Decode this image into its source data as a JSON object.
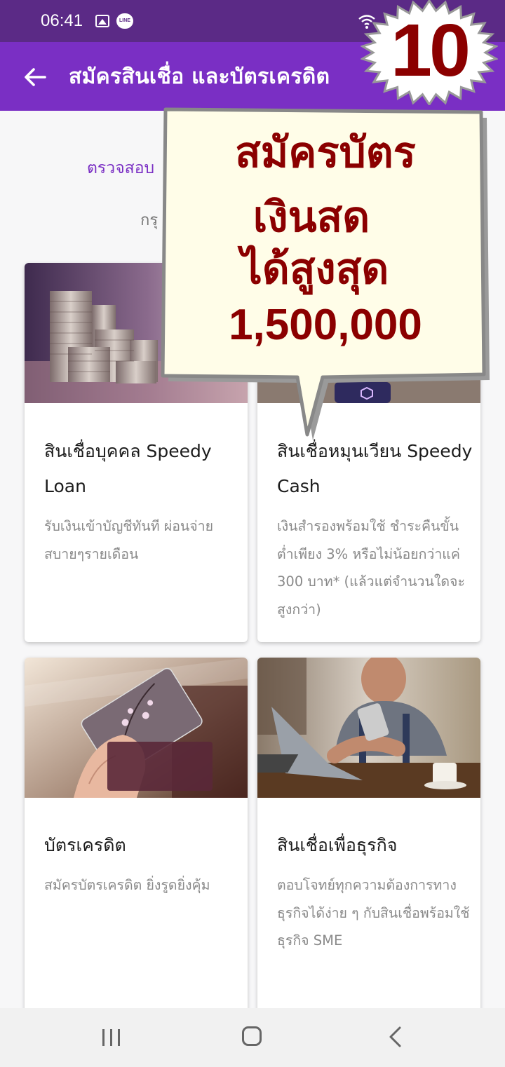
{
  "status_bar": {
    "time": "06:41",
    "line_icon_text": "LINE"
  },
  "app_bar": {
    "title": "สมัครสินเชื่อ และบัตรเครดิต"
  },
  "intro": {
    "check_link": "ตรวจสอบ",
    "subtext": "กรุ"
  },
  "cards": [
    {
      "title": "สินเชื่อบุคคล Speedy Loan",
      "description": "รับเงินเข้าบัญชีทันที ผ่อนจ่ายสบายๆรายเดือน"
    },
    {
      "title": "สินเชื่อหมุนเวียน Speedy Cash",
      "description": "เงินสำรองพร้อมใช้ ชำระคืนขั้นต่ำเพียง 3% หรือไม่น้อยกว่าแค่ 300 บาท* (แล้วแต่จำนวนใดจะสูงกว่า)"
    },
    {
      "title": "บัตรเครดิต",
      "description": "สมัครบัตรเครดิต ยิ่งรูดยิ่งคุ้ม"
    },
    {
      "title": "สินเชื่อเพื่อธุรกิจ",
      "description": "ตอบโจทย์ทุกความต้องการทางธุรกิจได้ง่าย ๆ กับสินเชื่อพร้อมใช้ธุรกิจ SME"
    }
  ],
  "promo": {
    "badge_number": "10",
    "callout_lines": [
      "สมัครบัตร",
      "เงินสด",
      "ได้สูงสุด",
      "1,500,000"
    ]
  },
  "colors": {
    "status_bar": "#5b2a86",
    "app_bar": "#7a2fc4",
    "accent_text": "#7a2fc4",
    "promo_text": "#8b0000",
    "callout_fill": "#fffde8"
  },
  "icons": [
    "gallery-icon",
    "line-app-icon",
    "wifi-icon",
    "back-arrow-icon",
    "recent-apps-icon",
    "home-icon",
    "back-icon"
  ]
}
